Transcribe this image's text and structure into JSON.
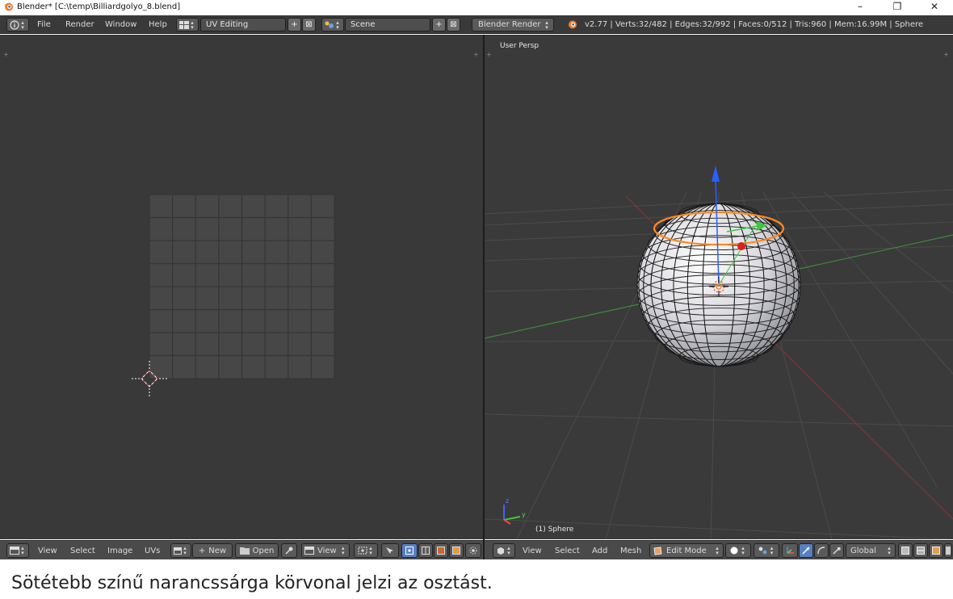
{
  "window": {
    "title": "Blender* [C:\\temp\\Billiardgolyo_8.blend]",
    "controls": [
      "–",
      "❐",
      "✕"
    ]
  },
  "info_header": {
    "menus": [
      "File",
      "Render",
      "Window",
      "Help"
    ],
    "layout": "UV Editing",
    "scene": "Scene",
    "engine": "Blender Render",
    "stats": "v2.77 | Verts:32/482 | Edges:32/992 | Faces:0/512 | Tris:960 | Mem:16.99M | Sphere"
  },
  "uv_editor": {
    "menus": [
      "View",
      "Select",
      "Image",
      "UVs"
    ],
    "new_label": "New",
    "open_label": "Open",
    "view_label": "View",
    "grid_size": 8
  },
  "viewport": {
    "view_name": "User Persp",
    "object_label": "(1) Sphere",
    "menus": [
      "View",
      "Select",
      "Add",
      "Mesh"
    ],
    "mode": "Edit Mode",
    "orientation": "Global",
    "axis_x": "y",
    "axis_z": "z"
  },
  "caption": "Sötétebb színű narancssárga körvonal jelzi az osztást.",
  "colors": {
    "selection": "#ff8a1e",
    "x_axis": "#ff3232",
    "y_axis": "#3cc83c",
    "z_axis": "#2860ff"
  }
}
